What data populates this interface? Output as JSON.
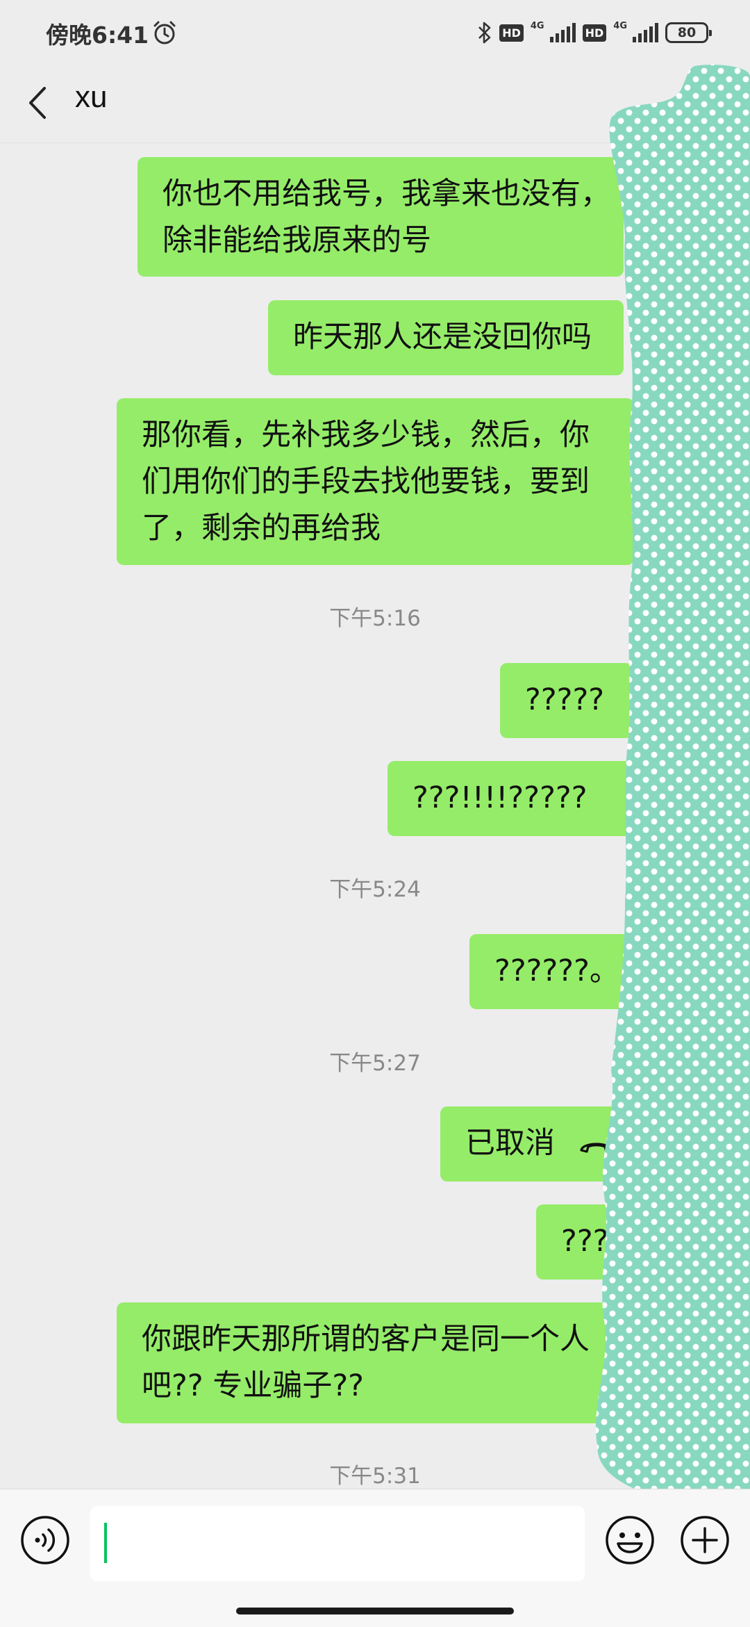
{
  "status_bar": {
    "time": "傍晚6:41",
    "hd1": "HD",
    "net1": "4G",
    "hd2": "HD",
    "net2": "4G",
    "battery": "80",
    "icons": [
      "alarm-icon",
      "bluetooth-icon",
      "signal-icon",
      "battery-icon"
    ]
  },
  "header": {
    "title": "xu",
    "back_icon": "chevron-left-icon",
    "more_icon": "more-icon"
  },
  "messages": [
    {
      "type": "sent",
      "lines": [
        "你也不用给我号，我拿来也没有，",
        "除非能给我原来的号"
      ]
    },
    {
      "type": "sent",
      "lines": [
        "昨天那人还是没回你吗"
      ]
    },
    {
      "type": "sent",
      "lines": [
        "那你看，先补我多少钱，然后，你",
        "们用你们的手段去找他要钱，要到",
        "了，剩余的再给我"
      ]
    },
    {
      "type": "time",
      "text": "下午5:16"
    },
    {
      "type": "sent",
      "lines": [
        "?????"
      ]
    },
    {
      "type": "sent",
      "lines": [
        "???!!!!?????"
      ]
    },
    {
      "type": "time",
      "text": "下午5:24"
    },
    {
      "type": "sent",
      "lines": [
        "??????。"
      ]
    },
    {
      "type": "time",
      "text": "下午5:27"
    },
    {
      "type": "sent",
      "lines": [
        "已取消"
      ],
      "icon": "hang-up-phone-icon"
    },
    {
      "type": "sent",
      "lines": [
        "???"
      ]
    },
    {
      "type": "sent",
      "lines": [
        "你跟昨天那所谓的客户是同一个人",
        "吧?? 专业骗子??"
      ]
    },
    {
      "type": "time",
      "text": "下午5:31"
    }
  ],
  "input_bar": {
    "input_value": "",
    "icons": [
      "voice-icon",
      "emoji-icon",
      "plus-icon"
    ]
  },
  "colors": {
    "background": "#ededed",
    "sent_bubble": "#95ec69",
    "redaction": "#88d8c0",
    "cursor": "#07c160"
  }
}
